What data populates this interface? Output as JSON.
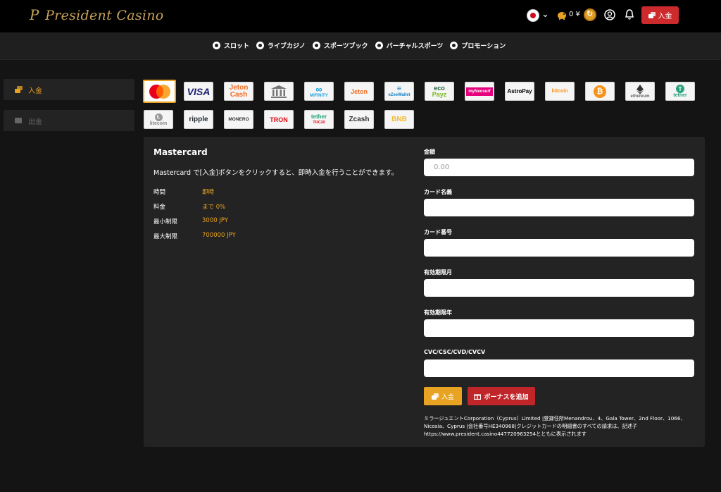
{
  "header": {
    "logo_mark": "P",
    "logo_text": "President Casino",
    "balance": "0 ¥",
    "deposit_label": "入金"
  },
  "nav": {
    "items": [
      {
        "label": "スロット",
        "icon": "slot-icon"
      },
      {
        "label": "ライブカジノ",
        "icon": "live-casino-icon"
      },
      {
        "label": "スポーツブック",
        "icon": "sportsbook-icon"
      },
      {
        "label": "バーチャルスポーツ",
        "icon": "virtual-sports-icon"
      },
      {
        "label": "プロモーション",
        "icon": "promotion-icon"
      }
    ]
  },
  "sidebar": {
    "items": [
      {
        "label": "入金",
        "active": true
      },
      {
        "label": "出金",
        "active": false
      }
    ]
  },
  "methods": {
    "row1": [
      "Mastercard",
      "VISA",
      "Jeton Cash",
      "Bank",
      "MiFINITY",
      "Jeton",
      "eZeeWallet",
      "ecoPayz",
      "myNeosurf",
      "AstroPay",
      "bitcoin",
      "Bitcoin Cash",
      "ethereum",
      "tether"
    ],
    "row2": [
      "litecoin",
      "ripple",
      "MONERO",
      "TRON",
      "tether TRC20",
      "Zcash",
      "BNB"
    ],
    "texts": {
      "visa": "VISA",
      "jetoncash_1": "Jeton",
      "jetoncash_2": "Cash",
      "mifinity": "MiFINITY",
      "jeton": "Jeton",
      "ezee": "eZeeWallet",
      "eco_1": "eco",
      "eco_2": "Payz",
      "neosurf": "myNeosurf",
      "astropay": "AstroPay",
      "bitcoin": "bitcoin",
      "ethereum": "ethereum",
      "tether": "tether",
      "litecoin": "litecoin",
      "ripple": "ripple",
      "monero": "MONERO",
      "tron": "TRON",
      "tether_trc_1": "tether",
      "tether_trc_2": "TRC20",
      "zcash": "Zcash",
      "bnb": "BNB"
    }
  },
  "panel": {
    "title": "Mastercard",
    "description": "Mastercard で[入金]ボタンをクリックすると、即時入金を行うことができます。",
    "info": [
      {
        "key": "時間",
        "value": "即時"
      },
      {
        "key": "料金",
        "value": "まで 0%"
      },
      {
        "key": "最小制限",
        "value": "3000 JPY"
      },
      {
        "key": "最大制限",
        "value": "700000 JPY"
      }
    ],
    "form": {
      "amount_label": "金額",
      "amount_placeholder": "0.00",
      "card_name_label": "カード名義",
      "card_number_label": "カード番号",
      "exp_month_label": "有効期限月",
      "exp_year_label": "有効期限年",
      "cvc_label": "CVC/CSC/CVD/CVCV"
    },
    "deposit_button": "入金",
    "bonus_button": "ボーナスを追加",
    "legal": "ミラージュエントCorporation（Cyprus）Limited |登録住所Menandrou、4、Gala Tower、2nd Floor、1066、Nicosia、Cyprus |会社番号HE340968|クレジットカードの明細書のすべての請求は、記述子https://www.president.casino447720963254とともに表示されます"
  },
  "colors": {
    "accent": "#e8a323",
    "danger": "#cc2a2d",
    "panel": "#232323",
    "bg": "#141414"
  }
}
